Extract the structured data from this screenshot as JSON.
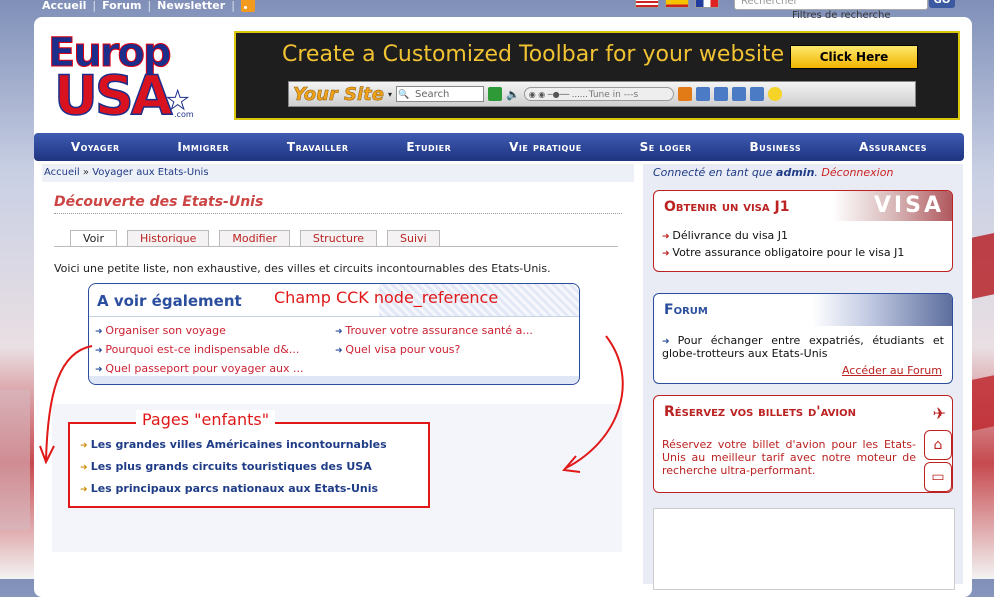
{
  "topnav": {
    "home": "Accueil",
    "forum": "Forum",
    "newsletter": "Newsletter",
    "sep": "|"
  },
  "search": {
    "placeholder": "Rechercher",
    "go": "GO",
    "filter_link": "Filtres de recherche"
  },
  "logo": {
    "line1": "Europ",
    "line2": "USA",
    "com": ".com"
  },
  "banner": {
    "headline": "Create a Customized Toolbar for your website",
    "cta": "Click Here",
    "toolbar_site": "Your Site",
    "toolbar_search": "Search",
    "toolbar_tune": "Tune in ---s"
  },
  "mainnav": [
    "Voyager",
    "Immigrer",
    "Travailler",
    "Etudier",
    "Vie pratique",
    "Se loger",
    "Business",
    "Assurances"
  ],
  "breadcrumb": {
    "home": "Accueil",
    "sep": " » ",
    "current": "Voyager aux Etats-Unis"
  },
  "page_title": "Découverte des Etats-Unis",
  "tabs": [
    "Voir",
    "Historique",
    "Modifier",
    "Structure",
    "Suivi"
  ],
  "intro": "Voici une petite liste, non exhaustive, des villes et circuits incontournables des Etats-Unis.",
  "see_also": {
    "title": "A voir également",
    "col1": [
      "Organiser son voyage",
      "Pourquoi est-ce indispensable d&...",
      "Quel passeport pour voyager aux ..."
    ],
    "col2": [
      "Trouver votre assurance santé a...",
      "Quel visa pour vous?"
    ]
  },
  "annotations": {
    "cck": "Champ CCK node_reference",
    "children": "Pages \"enfants\""
  },
  "children_pages": [
    "Les grandes villes Américaines incontournables",
    "Les plus grands circuits touristiques des USA",
    "Les principaux parcs nationaux aux Etats-Unis"
  ],
  "sidebar": {
    "logged_prefix": "Connecté en tant que ",
    "user": "admin",
    "logged_mid": ". ",
    "logout": "Déconnexion",
    "visa": {
      "title": "Obtenir un visa J1",
      "image_text": "VISA",
      "items": [
        "Délivrance du visa J1",
        "Votre assurance obligatoire pour le visa J1"
      ]
    },
    "forum": {
      "title": "Forum",
      "text": "Pour échanger entre expatriés, étudiants et globe-trotteurs aux Etats-Unis",
      "link": "Accéder au Forum"
    },
    "flights": {
      "title": "Réservez vos billets d'avion",
      "text": "Réservez votre billet d'avion pour les Etats-Unis au meilleur tarif avec notre moteur de recherche ultra-performant."
    }
  },
  "colors": {
    "nav": "#2a4596",
    "accent_red": "#b22222",
    "annotation_red": "#e01818",
    "link_blue": "#1f3c86"
  }
}
